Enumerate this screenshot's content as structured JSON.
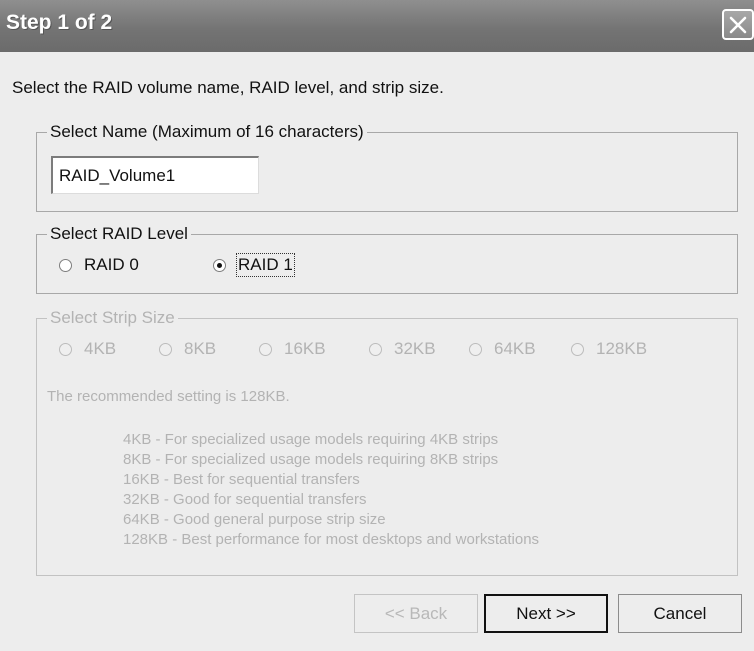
{
  "window": {
    "title": "Step 1 of 2"
  },
  "instruction": "Select the RAID volume name, RAID level, and strip size.",
  "name_group": {
    "legend": "Select Name (Maximum of 16 characters)",
    "input_value": "RAID_Volume1"
  },
  "level_group": {
    "legend": "Select RAID Level",
    "options": [
      {
        "label": "RAID 0",
        "checked": false
      },
      {
        "label": "RAID 1",
        "checked": true
      }
    ]
  },
  "strip_group": {
    "legend": "Select Strip Size",
    "enabled": false,
    "options": [
      "4KB",
      "8KB",
      "16KB",
      "32KB",
      "64KB",
      "128KB"
    ],
    "hint": "The recommended setting is 128KB.",
    "descriptions": [
      "4KB - For specialized usage models requiring 4KB strips",
      "8KB - For specialized usage models requiring 8KB strips",
      "16KB - Best for sequential transfers",
      "32KB - Good for sequential transfers",
      "64KB - Good general purpose strip size",
      "128KB - Best performance for most desktops and workstations"
    ]
  },
  "buttons": {
    "back": "<< Back",
    "next": "Next >>",
    "cancel": "Cancel"
  },
  "colors": {
    "titlebar": "#747474",
    "dialog_background": "#ededed",
    "disabled_text": "#b3b3b3"
  },
  "icons": {
    "close": "close-icon"
  }
}
